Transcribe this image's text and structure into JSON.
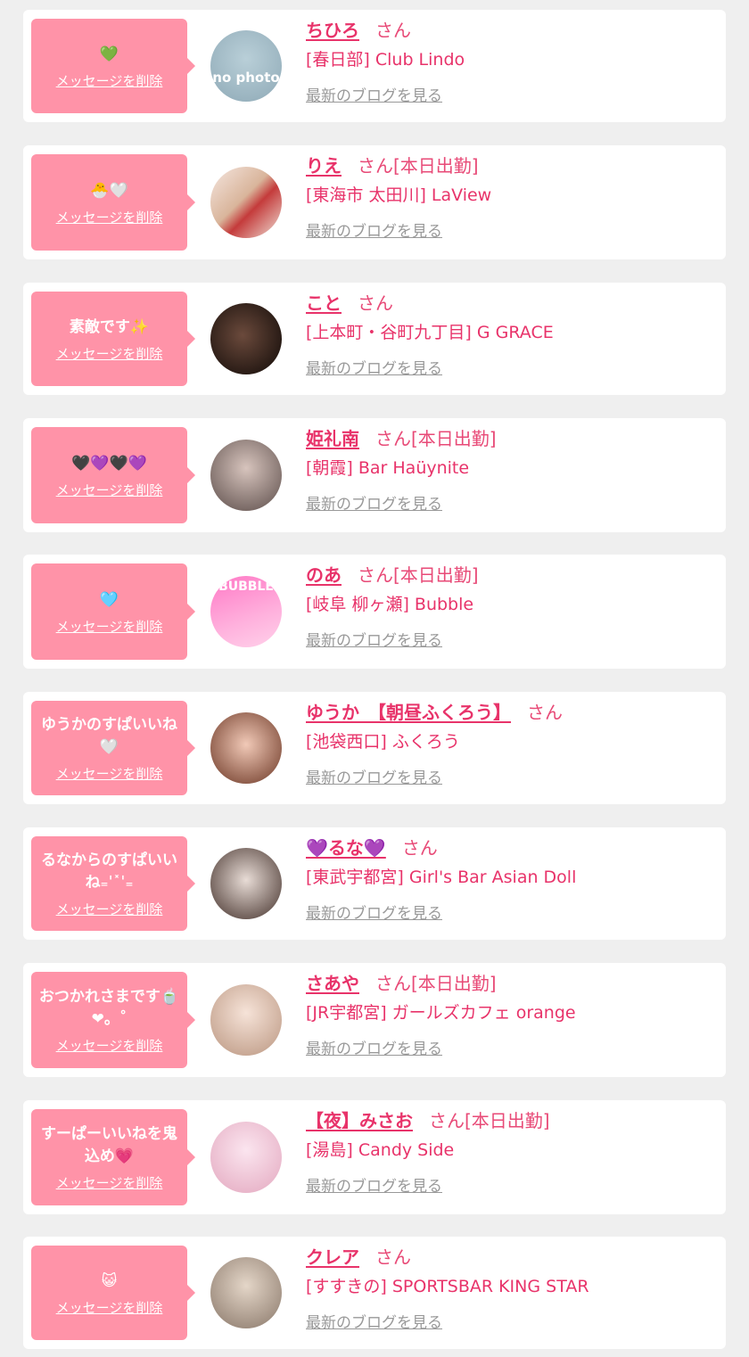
{
  "common": {
    "delete_label": "メッセージを削除",
    "blog_label": "最新のブログを見る",
    "san_label": "さん"
  },
  "colors": {
    "bubble": "#ff93a8",
    "accent": "#e8336a",
    "link_gray": "#999999",
    "background": "#efefef"
  },
  "items": [
    {
      "message": "💚",
      "name": "ちひろ",
      "work": "",
      "shop": "[春日部] Club Lindo",
      "avatar": {
        "kind": "no-photo",
        "text": "no photo"
      }
    },
    {
      "message": "🐣🤍",
      "name": "りえ",
      "work": "[本日出勤]",
      "shop": "[東海市 太田川] LaView",
      "avatar": {
        "kind": "photo",
        "text": ""
      }
    },
    {
      "message": "素敵です✨",
      "name": "こと",
      "work": "",
      "shop": "[上本町・谷町九丁目] G GRACE",
      "avatar": {
        "kind": "photo",
        "text": ""
      }
    },
    {
      "message": "🖤💜🖤💜",
      "name": "姫礼南",
      "work": "[本日出勤]",
      "shop": "[朝霞] Bar Haüynite",
      "avatar": {
        "kind": "photo",
        "text": ""
      }
    },
    {
      "message": "🩵",
      "name": "のあ",
      "work": "[本日出勤]",
      "shop": "[岐阜 柳ヶ瀬] Bubble",
      "avatar": {
        "kind": "photo",
        "text": "BUBBLE"
      }
    },
    {
      "message": "ゆうかのすぱいいね🤍",
      "name": "ゆうか　【朝昼ふくろう】",
      "work": "",
      "shop": "[池袋西口] ふくろう",
      "avatar": {
        "kind": "photo",
        "text": ""
      }
    },
    {
      "message": "るなからのすぱいいね₌ˈ˟ˈ₌",
      "name": "💜るな💜",
      "work": "",
      "shop": "[東武宇都宮] Girl's Bar Asian Doll",
      "avatar": {
        "kind": "photo",
        "text": ""
      }
    },
    {
      "message": "おつかれさまです🍵❤。˚",
      "name": "さあや",
      "work": "[本日出勤]",
      "shop": "[JR宇都宮] ガールズカフェ orange",
      "avatar": {
        "kind": "photo",
        "text": ""
      }
    },
    {
      "message": "すーぱーいいねを鬼込め💗",
      "name": "【夜】みさお",
      "work": "[本日出勤]",
      "shop": "[湯島] Candy Side",
      "avatar": {
        "kind": "photo",
        "text": ""
      }
    },
    {
      "message": "😺",
      "name": "クレア",
      "work": "",
      "shop": "[すすきの] SPORTSBAR KING STAR",
      "avatar": {
        "kind": "photo",
        "text": ""
      }
    }
  ]
}
